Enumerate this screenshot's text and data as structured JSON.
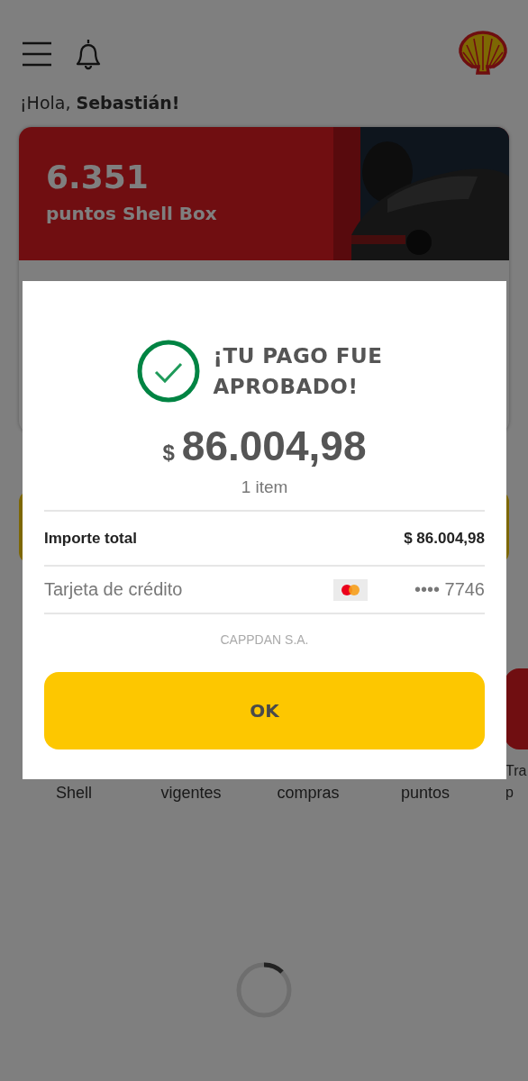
{
  "header": {
    "greeting": "¡Hola, **Sebastián!**"
  },
  "points_card": {
    "points": "6.351",
    "label": "puntos Shell Box"
  },
  "shortcuts": [
    {
      "lines": [
        "Shell"
      ]
    },
    {
      "lines": [
        "vigentes"
      ]
    },
    {
      "lines": [
        "compras"
      ]
    },
    {
      "lines": [
        "puntos"
      ]
    },
    {
      "lines": [
        "Tra",
        "p"
      ]
    }
  ],
  "dialog": {
    "title": "¡TU PAGO FUE APROBADO!",
    "currency": "$",
    "amount": "86.004,98",
    "items": "1 item",
    "rows": [
      {
        "kind": "total",
        "label": "Importe total",
        "value": "$ 86.004,98"
      },
      {
        "kind": "card",
        "label": "Tarjeta de crédito",
        "value": "•••• 7746"
      }
    ],
    "merchant": "CAPPDAN S.A.",
    "button": "OK"
  }
}
